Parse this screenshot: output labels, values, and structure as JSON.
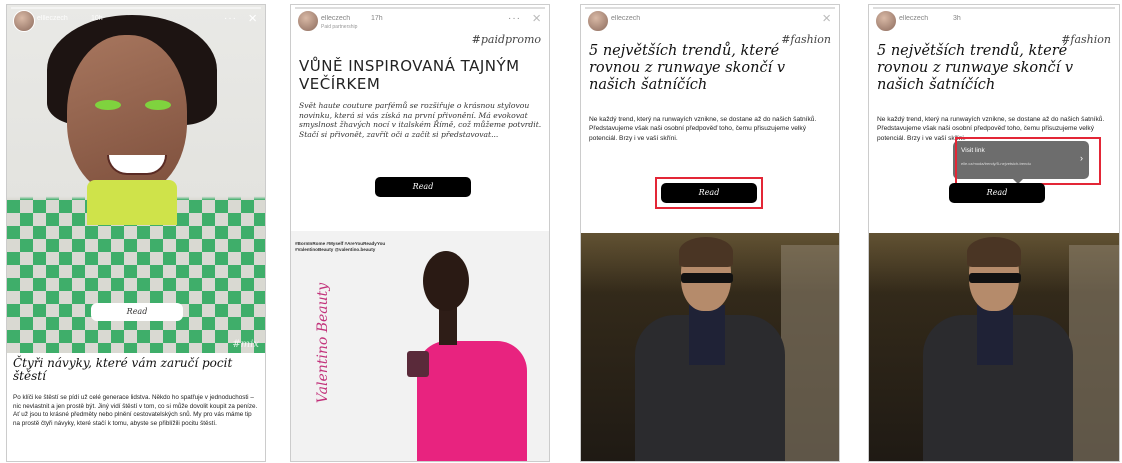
{
  "stories": [
    {
      "username": "ellleczech",
      "time": "10h",
      "read_label": "Read",
      "tag": "#mix",
      "title": "Čtyři návyky, které vám zaručí pocit štěstí",
      "body": "Po klíči ke štěstí se pídí už celé generace lidstva. Někdo ho spatřuje v jednoduchosti – nic nevlastnit a jen prostě být. Jiný vidí štěstí v tom, co si může dovolit koupit za peníze. Ať už jsou to krásné předměty nebo plnění cestovatelských snů. My pro vás máme tip na prostě čtyři návyky, které stačí k tomu, abyste se přiblížili pocitu štěstí."
    },
    {
      "username": "elleczech",
      "time": "17h",
      "subline": "Paid partnership",
      "hashtag": "#paidpromo",
      "title": "VŮNĚ INSPIROVANÁ TAJNÝM VEČÍRKEM",
      "body": "Svět haute couture parfémů se rozšiřuje o krásnou stylovou novinku, která si vás získá na první přivonění. Má evokovat smyslnost žhavých nocí v italském Římě, což můžeme potvrdit. Stačí si přivonět, zavřít oči a začít si představovat...",
      "read_label": "Read",
      "image_hashtags": "#BornInRome #Myself #AreYouReadyYou #ValentinoBeauty @valentino.beauty",
      "brand": "Valentino Beauty"
    },
    {
      "username": "elleczech",
      "hashtag": "#fashion",
      "title": "5 největších trendů, které rovnou z runwaye skončí v našich šatníčích",
      "body": "Ne každý trend, který na runwayích vznikne, se dostane až do našich šatníků. Představujeme však naši osobní předpověď toho, čemu přisuzujeme velký potenciál. Brzy i ve vaší skříni.",
      "read_label": "Read"
    },
    {
      "username": "elleczech",
      "time": "3h",
      "hashtag": "#fashion",
      "title": "5 největších trendů, které rovnou z runwaye skončí v našich šatníčích",
      "body": "Ne každý trend, který na runwayích vznikne, se dostane až do našich šatníků. Představujeme však naši osobní předpověď toho, čemu přisuzujeme velký potenciál. Brzy i ve vaší skříni.",
      "read_label": "Read",
      "tooltip_title": "Visit link",
      "tooltip_url": "elle.cz/moda/trendy/5-nejvetsich-trendu"
    }
  ],
  "icons": {
    "close": "×",
    "more": "···",
    "chevron": "›"
  },
  "colors": {
    "highlight": "#e32636",
    "button": "#000000",
    "brand_pink": "#c2317a"
  }
}
